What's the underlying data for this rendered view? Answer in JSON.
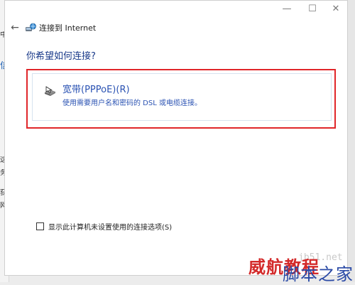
{
  "background": {
    "left_fragments": [
      "中",
      "信",
      "这",
      "务",
      "获",
      "网"
    ]
  },
  "window": {
    "controls": {
      "minimize": "—",
      "maximize": "☐",
      "close": "✕"
    }
  },
  "wizard": {
    "back_symbol": "←",
    "title": "连接到 Internet",
    "question": "你希望如何连接?",
    "option": {
      "title": "宽带(PPPoE)(R)",
      "description": "使用需要用户名和密码的 DSL 或电缆连接。"
    },
    "checkbox": {
      "label": "显示此计算机未设置使用的连接选项(S)",
      "checked": false
    }
  },
  "watermark": {
    "domain": "jb51.net",
    "text_red": "威航教程",
    "text_blue": "脚本之家"
  },
  "colors": {
    "highlight_border": "#e0262a",
    "link_blue": "#2b53b3",
    "heading_blue": "#1a3a8a"
  }
}
